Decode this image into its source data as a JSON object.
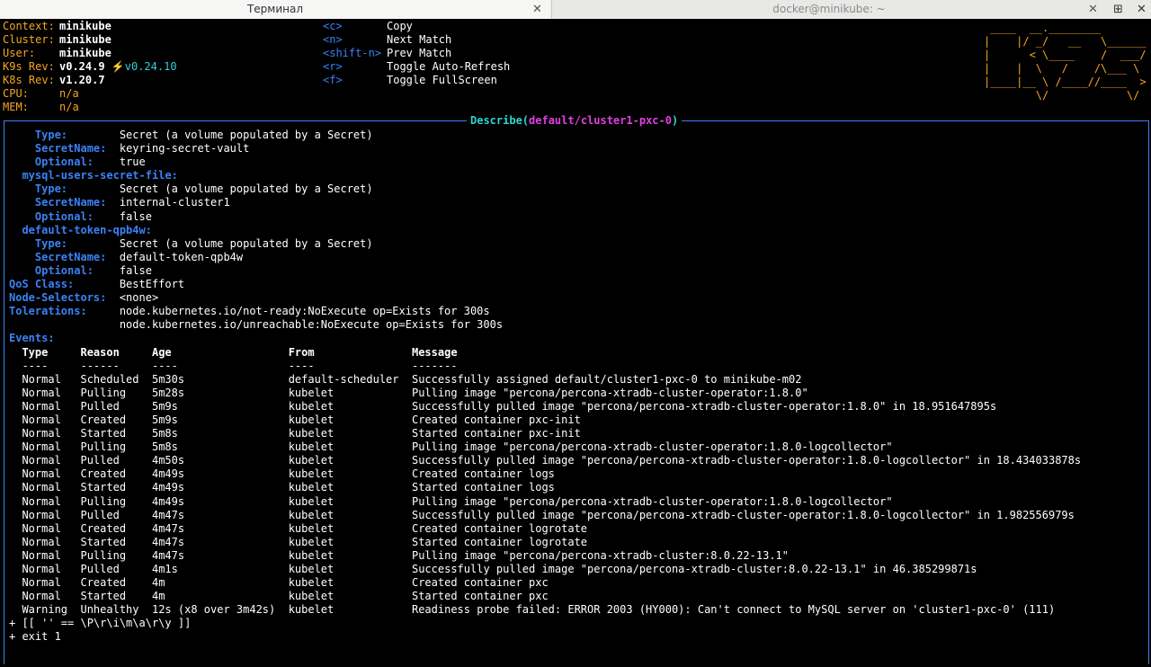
{
  "tabs": [
    {
      "title": "Терминал",
      "active": true
    },
    {
      "title": "docker@minikube: ~",
      "active": false
    }
  ],
  "window_buttons": {
    "new_tab": "⊞",
    "close": "✕"
  },
  "header": {
    "info": [
      {
        "key": "Context:",
        "value": "minikube"
      },
      {
        "key": "Cluster:",
        "value": "minikube"
      },
      {
        "key": "User:",
        "value": "minikube"
      },
      {
        "key": "K9s Rev:",
        "value": "v0.24.9",
        "extra": "⚡️v0.24.10"
      },
      {
        "key": "K8s Rev:",
        "value": "v1.20.7"
      },
      {
        "key": "CPU:",
        "value": "n/a"
      },
      {
        "key": "MEM:",
        "value": "n/a"
      }
    ],
    "shortcuts": [
      {
        "key": "<c>",
        "action": "Copy"
      },
      {
        "key": "<n>",
        "action": "Next Match"
      },
      {
        "key": "<shift-n>",
        "action": "Prev Match"
      },
      {
        "key": "<r>",
        "action": "Toggle Auto-Refresh"
      },
      {
        "key": "<f>",
        "action": "Toggle FullScreen"
      }
    ],
    "logo_lines": [
      " ____  __.________       ",
      "|    |/ _/   __   \\______",
      "|      < \\____    /  ___/",
      "|    |  \\   /    /\\___ \\ ",
      "|____|__ \\ /____//____  >",
      "        \\/            \\/ "
    ]
  },
  "describe": {
    "title_prefix": "Describe(",
    "title_resource": "default/cluster1-pxc-0",
    "title_suffix": ")"
  },
  "volumes": [
    {
      "name": null,
      "fields": [
        {
          "k": "Type:",
          "v": "Secret (a volume populated by a Secret)"
        },
        {
          "k": "SecretName:",
          "v": "keyring-secret-vault"
        },
        {
          "k": "Optional:",
          "v": "true"
        }
      ]
    },
    {
      "name": "mysql-users-secret-file:",
      "fields": [
        {
          "k": "Type:",
          "v": "Secret (a volume populated by a Secret)"
        },
        {
          "k": "SecretName:",
          "v": "internal-cluster1"
        },
        {
          "k": "Optional:",
          "v": "false"
        }
      ]
    },
    {
      "name": "default-token-qpb4w:",
      "fields": [
        {
          "k": "Type:",
          "v": "Secret (a volume populated by a Secret)"
        },
        {
          "k": "SecretName:",
          "v": "default-token-qpb4w"
        },
        {
          "k": "Optional:",
          "v": "false"
        }
      ]
    }
  ],
  "pod_fields": [
    {
      "k": "QoS Class:",
      "v": "BestEffort"
    },
    {
      "k": "Node-Selectors:",
      "v": "<none>"
    },
    {
      "k": "Tolerations:",
      "v": "node.kubernetes.io/not-ready:NoExecute op=Exists for 300s"
    },
    {
      "k": "",
      "v": "node.kubernetes.io/unreachable:NoExecute op=Exists for 300s"
    }
  ],
  "events": {
    "label": "Events:",
    "headers": [
      "Type",
      "Reason",
      "Age",
      "From",
      "Message"
    ],
    "dashes": [
      "----",
      "------",
      "----",
      "----",
      "-------"
    ],
    "rows": [
      [
        "Normal",
        "Scheduled",
        "5m30s",
        "default-scheduler",
        "Successfully assigned default/cluster1-pxc-0 to minikube-m02"
      ],
      [
        "Normal",
        "Pulling",
        "5m28s",
        "kubelet",
        "Pulling image \"percona/percona-xtradb-cluster-operator:1.8.0\""
      ],
      [
        "Normal",
        "Pulled",
        "5m9s",
        "kubelet",
        "Successfully pulled image \"percona/percona-xtradb-cluster-operator:1.8.0\" in 18.951647895s"
      ],
      [
        "Normal",
        "Created",
        "5m9s",
        "kubelet",
        "Created container pxc-init"
      ],
      [
        "Normal",
        "Started",
        "5m8s",
        "kubelet",
        "Started container pxc-init"
      ],
      [
        "Normal",
        "Pulling",
        "5m8s",
        "kubelet",
        "Pulling image \"percona/percona-xtradb-cluster-operator:1.8.0-logcollector\""
      ],
      [
        "Normal",
        "Pulled",
        "4m50s",
        "kubelet",
        "Successfully pulled image \"percona/percona-xtradb-cluster-operator:1.8.0-logcollector\" in 18.434033878s"
      ],
      [
        "Normal",
        "Created",
        "4m49s",
        "kubelet",
        "Created container logs"
      ],
      [
        "Normal",
        "Started",
        "4m49s",
        "kubelet",
        "Started container logs"
      ],
      [
        "Normal",
        "Pulling",
        "4m49s",
        "kubelet",
        "Pulling image \"percona/percona-xtradb-cluster-operator:1.8.0-logcollector\""
      ],
      [
        "Normal",
        "Pulled",
        "4m47s",
        "kubelet",
        "Successfully pulled image \"percona/percona-xtradb-cluster-operator:1.8.0-logcollector\" in 1.982556979s"
      ],
      [
        "Normal",
        "Created",
        "4m47s",
        "kubelet",
        "Created container logrotate"
      ],
      [
        "Normal",
        "Started",
        "4m47s",
        "kubelet",
        "Started container logrotate"
      ],
      [
        "Normal",
        "Pulling",
        "4m47s",
        "kubelet",
        "Pulling image \"percona/percona-xtradb-cluster:8.0.22-13.1\""
      ],
      [
        "Normal",
        "Pulled",
        "4m1s",
        "kubelet",
        "Successfully pulled image \"percona/percona-xtradb-cluster:8.0.22-13.1\" in 46.385299871s"
      ],
      [
        "Normal",
        "Created",
        "4m",
        "kubelet",
        "Created container pxc"
      ],
      [
        "Normal",
        "Started",
        "4m",
        "kubelet",
        "Started container pxc"
      ],
      [
        "Warning",
        "Unhealthy",
        "12s (x8 over 3m42s)",
        "kubelet",
        "Readiness probe failed: ERROR 2003 (HY000): Can't connect to MySQL server on 'cluster1-pxc-0' (111)"
      ]
    ],
    "trailer": [
      "+ [[ '' == \\P\\r\\i\\m\\a\\r\\y ]]",
      "+ exit 1"
    ]
  }
}
